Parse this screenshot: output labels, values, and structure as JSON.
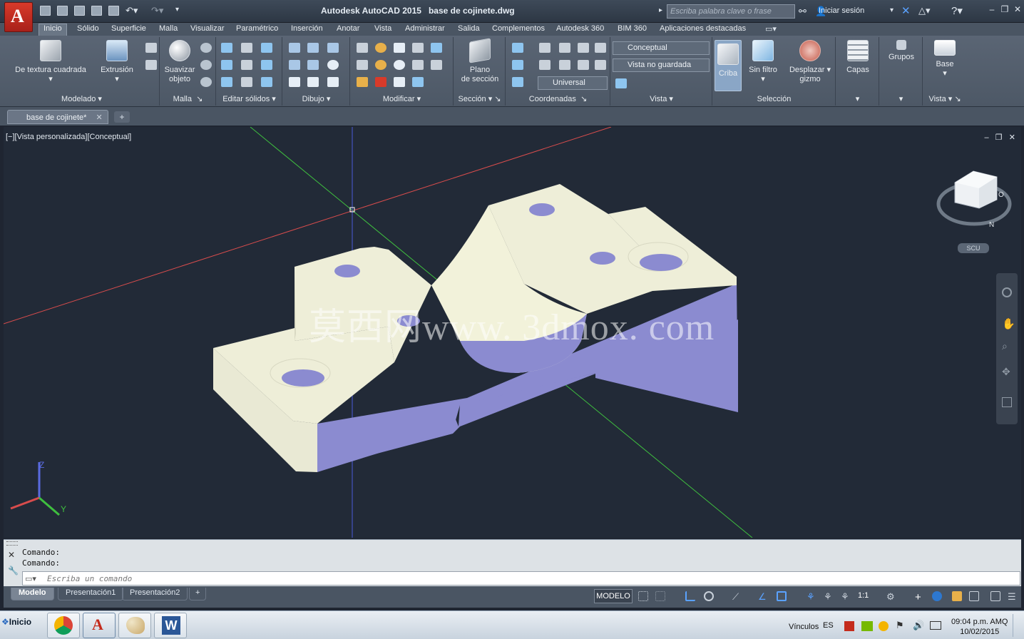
{
  "title_bar": {
    "app_title": "Autodesk AutoCAD 2015",
    "file_name": "base de cojinete.dwg",
    "search_placeholder": "Escriba palabra clave o frase",
    "signin_label": "Iniciar sesión",
    "app_button_letter": "A"
  },
  "menu_tabs": [
    "Inicio",
    "Sólido",
    "Superficie",
    "Malla",
    "Visualizar",
    "Paramétrico",
    "Inserción",
    "Anotar",
    "Vista",
    "Administrar",
    "Salida",
    "Complementos",
    "Autodesk 360",
    "BIM 360",
    "Aplicaciones destacadas"
  ],
  "ribbon": {
    "modelado": {
      "title": "Modelado",
      "btn1": "De textura cuadrada",
      "btn2": "Extrusión"
    },
    "malla": {
      "title": "Malla",
      "btn1_line1": "Suavizar",
      "btn1_line2": "objeto"
    },
    "editar_solidos": {
      "title": "Editar sólidos"
    },
    "dibujo": {
      "title": "Dibujo"
    },
    "modificar": {
      "title": "Modificar"
    },
    "seccion": {
      "title": "Sección",
      "btn1_line1": "Plano",
      "btn1_line2": "de sección"
    },
    "coordenadas": {
      "title": "Coordenadas",
      "ucs_value": "Universal"
    },
    "vista": {
      "title": "Vista",
      "visual_style": "Conceptual",
      "named_view": "Vista no guardada"
    },
    "seleccion": {
      "title": "Selección",
      "btn_criba": "Criba",
      "btn_sinfiltro": "Sin filtro",
      "btn_gizmo_line1": "Desplazar",
      "btn_gizmo_line2": "gizmo"
    },
    "capas": {
      "label": "Capas"
    },
    "grupos": {
      "label": "Grupos"
    },
    "vista_base": {
      "title": "Vista",
      "label": "Base"
    }
  },
  "doc_tab": {
    "label": "base de cojinete*"
  },
  "viewport": {
    "label": "[−][Vista personalizada][Conceptual]",
    "viewcube_scu": "SCU",
    "watermark": "莫西网www. 3dmox. com"
  },
  "command": {
    "history": [
      "Comando:",
      "Comando:"
    ],
    "placeholder": "Escriba un comando"
  },
  "layout_tabs": [
    "Modelo",
    "Presentación1",
    "Presentación2"
  ],
  "status": {
    "model_label": "MODELO",
    "scale": "1:1"
  },
  "taskbar": {
    "start": "Inicio",
    "vinculos": "Vínculos",
    "lang": "ES",
    "time": "09:04 p.m. AMQ",
    "date": "10/02/2015"
  },
  "colors": {
    "viewport_bg": "#222a37",
    "part_top": "#eeeed8",
    "part_side": "#8b8bd0",
    "accent_red": "#c42b1c"
  }
}
